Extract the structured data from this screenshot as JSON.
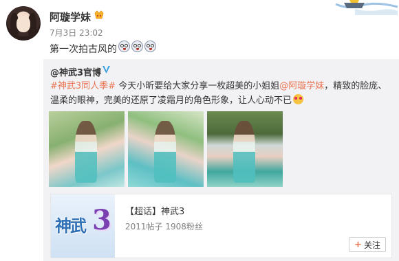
{
  "post": {
    "username": "阿璇学妹",
    "time": "7月3日 23:02",
    "text": "第一次拍古风的"
  },
  "repost": {
    "source_user": "@神武3官博",
    "tag": "#神武3同人季#",
    "text_before_mention": " 今天小昕要给大家分享一枚超美的小姐姐",
    "mention": "@阿璇学妹",
    "text_after_mention": "，精致的脸庞、温柔的眼神，完美的还原了凌霜月的角色形象，让人心动不已"
  },
  "topic": {
    "logo_text": "神武",
    "logo_num": "3",
    "title": "【超话】神武3",
    "meta": "2011帖子 1908粉丝",
    "follow_label": "关注"
  }
}
